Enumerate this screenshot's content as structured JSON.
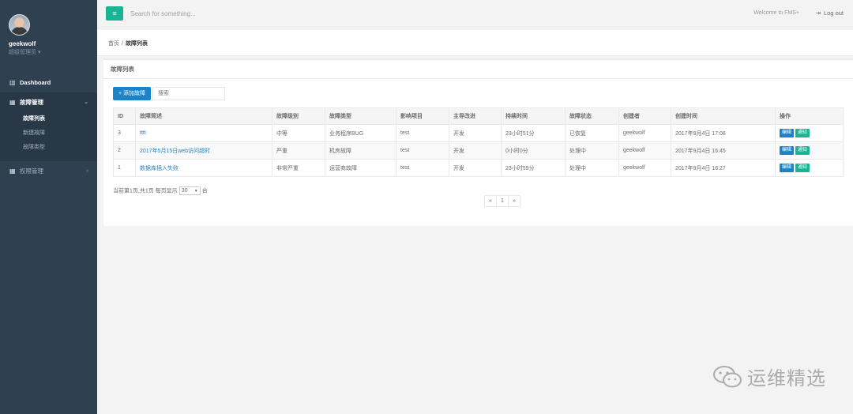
{
  "profile": {
    "name": "geekwolf",
    "role": "超级管理员 ▾"
  },
  "nav": {
    "dashboard": {
      "icon": "chart-icon",
      "label": "Dashboard"
    },
    "fault_mgmt": {
      "icon": "grid-icon",
      "label": "故障管理",
      "caret": "⌄"
    },
    "sub_items": [
      {
        "label": "故障列表",
        "active": true
      },
      {
        "label": "新建故障",
        "active": false
      },
      {
        "label": "故障类型",
        "active": false
      }
    ],
    "perm_mgmt": {
      "icon": "grid-icon",
      "label": "权限管理",
      "caret": "‹"
    }
  },
  "topbar": {
    "menu_icon": "≡",
    "search_placeholder": "Search for something...",
    "welcome": "Welcome to FMS+",
    "logout_label": "Log out",
    "logout_icon": "⇥"
  },
  "breadcrumb": {
    "home": "首页",
    "sep": "/",
    "current": "故障列表"
  },
  "panel": {
    "title": "故障列表",
    "add_button": "+ 添加故障",
    "filter_placeholder": "搜索"
  },
  "table": {
    "headers": [
      "ID",
      "故障简述",
      "故障级别",
      "故障类型",
      "影响项目",
      "主导改进",
      "持续时间",
      "故障状态",
      "创建者",
      "创建时间",
      "操作"
    ],
    "rows": [
      {
        "id": "3",
        "summary": "tttt",
        "level": "中等",
        "type": "业务程序BUG",
        "project": "test",
        "lead": "开发",
        "duration": "23小时51分",
        "status": "已恢复",
        "creator": "geekwolf",
        "created": "2017年9月4日 17:08",
        "ops": [
          "编辑",
          "通知"
        ]
      },
      {
        "id": "2",
        "summary": "2017年5月15日web访问超时",
        "level": "严重",
        "type": "机房故障",
        "project": "test",
        "lead": "开发",
        "duration": "0小时0分",
        "status": "处理中",
        "creator": "geekwolf",
        "created": "2017年9月4日 16:45",
        "ops": [
          "编辑",
          "通知"
        ]
      },
      {
        "id": "1",
        "summary": "数据库插入失败",
        "level": "非常严重",
        "type": "运营商故障",
        "project": "test",
        "lead": "开发",
        "duration": "23小时59分",
        "status": "处理中",
        "creator": "geekwolf",
        "created": "2017年9月4日 16:27",
        "ops": [
          "编辑",
          "通知"
        ]
      }
    ]
  },
  "pagination": {
    "info_prefix": "当前第1页,共1页 每页显示",
    "page_size": "30",
    "info_suffix": "台",
    "prev": "«",
    "current": "1",
    "next": "»"
  },
  "watermark": {
    "text": "运维精选"
  }
}
